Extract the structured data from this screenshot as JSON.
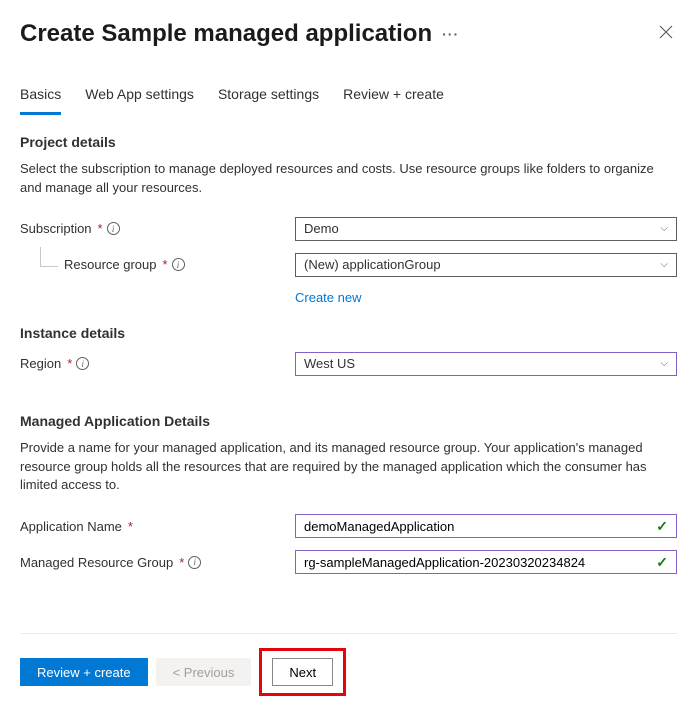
{
  "header": {
    "title": "Create Sample managed application"
  },
  "tabs": [
    {
      "label": "Basics",
      "active": true
    },
    {
      "label": "Web App settings",
      "active": false
    },
    {
      "label": "Storage settings",
      "active": false
    },
    {
      "label": "Review + create",
      "active": false
    }
  ],
  "projectDetails": {
    "title": "Project details",
    "description": "Select the subscription to manage deployed resources and costs. Use resource groups like folders to organize and manage all your resources.",
    "subscription": {
      "label": "Subscription",
      "value": "Demo"
    },
    "resourceGroup": {
      "label": "Resource group",
      "value": "(New) applicationGroup",
      "createNew": "Create new"
    }
  },
  "instanceDetails": {
    "title": "Instance details",
    "region": {
      "label": "Region",
      "value": "West US"
    }
  },
  "managedAppDetails": {
    "title": "Managed Application Details",
    "description": "Provide a name for your managed application, and its managed resource group. Your application's managed resource group holds all the resources that are required by the managed application which the consumer has limited access to.",
    "applicationName": {
      "label": "Application Name",
      "value": "demoManagedApplication"
    },
    "managedResourceGroup": {
      "label": "Managed Resource Group",
      "value": "rg-sampleManagedApplication-20230320234824"
    }
  },
  "footer": {
    "review": "Review + create",
    "previous": "< Previous",
    "next": "Next"
  }
}
